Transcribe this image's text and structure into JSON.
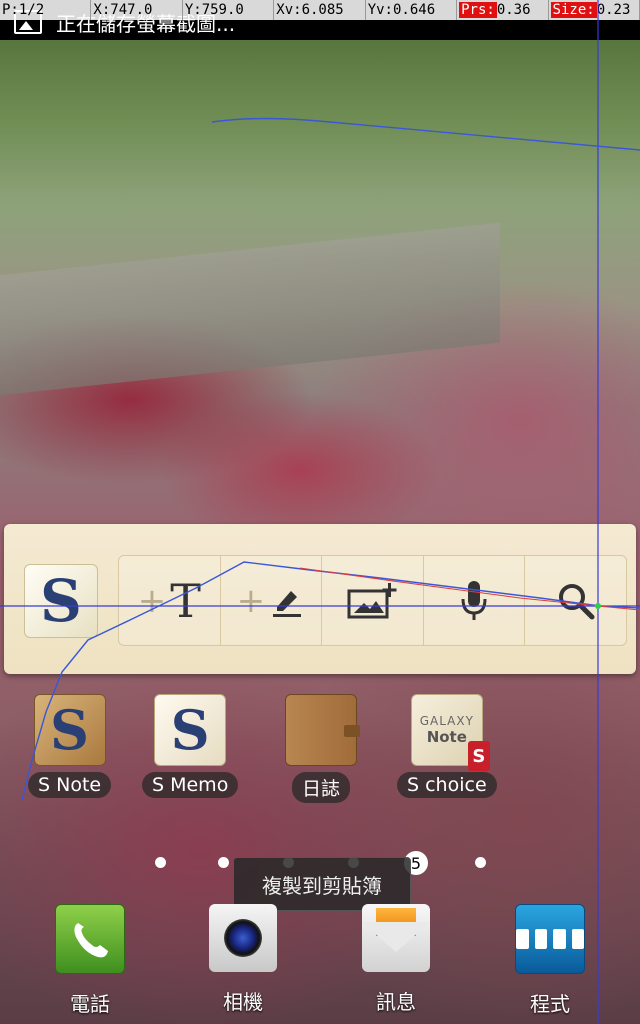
{
  "status_bar": {
    "pointer_info": [
      {
        "key": "P:",
        "value": "1/2"
      },
      {
        "key": "X:",
        "value": "747.0"
      },
      {
        "key": "Y:",
        "value": "759.0"
      },
      {
        "key": "Xv:",
        "value": "6.085"
      },
      {
        "key": "Yv:",
        "value": "0.646"
      },
      {
        "key": "Prs:",
        "value": "0.36"
      },
      {
        "key": "Size:",
        "value": "0.23"
      }
    ],
    "notification_text": "正在儲存螢幕截圖..."
  },
  "snote_widget": {
    "logo_glyph": "S",
    "tools": [
      {
        "name": "add-text",
        "glyph": "T"
      },
      {
        "name": "add-handwriting",
        "glyph": "✎"
      },
      {
        "name": "add-image",
        "glyph": "▭"
      },
      {
        "name": "voice",
        "glyph": "🎤"
      },
      {
        "name": "search",
        "glyph": "⌕"
      }
    ]
  },
  "apps": [
    {
      "label": "S Note",
      "glyph": "S"
    },
    {
      "label": "S Memo",
      "glyph": "S"
    },
    {
      "label": "日誌",
      "glyph": ""
    },
    {
      "label": "S choice",
      "glyph": "S"
    }
  ],
  "schoice_icon": {
    "line1": "GALAXY",
    "line2": "Note"
  },
  "pager": {
    "current_page": "5"
  },
  "toast": "複製到剪貼簿",
  "dock": [
    {
      "label": "電話",
      "icon": "phone-icon"
    },
    {
      "label": "相機",
      "icon": "camera-icon"
    },
    {
      "label": "訊息",
      "icon": "message-icon"
    },
    {
      "label": "程式",
      "icon": "apps-grid-icon"
    }
  ],
  "colors": {
    "pointer_trail": "#3a57d8",
    "highlight_red": "#e01010",
    "widget_bg": "#f2e7cc"
  }
}
